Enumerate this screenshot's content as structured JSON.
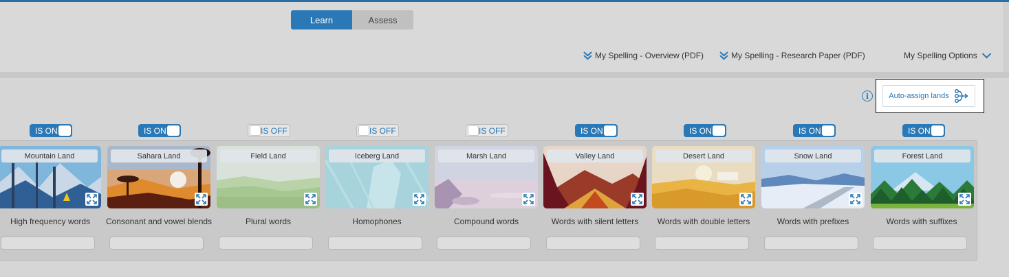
{
  "mode_toggle": {
    "learn_label": "Learn",
    "assess_label": "Assess",
    "active": "Learn"
  },
  "links": {
    "overview": "My Spelling - Overview (PDF)",
    "research": "My Spelling - Research Paper (PDF)",
    "options": "My Spelling Options"
  },
  "auto_assign": {
    "label": "Auto-assign lands",
    "info_glyph": "i"
  },
  "colors": {
    "accent": "#2a78b5",
    "toggle_on": "#2a78b5",
    "toggle_off": "#e6e6e6"
  },
  "lands": [
    {
      "name": "Mountain Land",
      "description": "High frequency words",
      "toggle": "IS ON",
      "input_value": ""
    },
    {
      "name": "Sahara Land",
      "description": "Consonant and vowel blends",
      "toggle": "IS ON",
      "input_value": ""
    },
    {
      "name": "Field Land",
      "description": "Plural words",
      "toggle": "IS OFF",
      "input_value": ""
    },
    {
      "name": "Iceberg Land",
      "description": "Homophones",
      "toggle": "IS OFF",
      "input_value": ""
    },
    {
      "name": "Marsh Land",
      "description": "Compound words",
      "toggle": "IS OFF",
      "input_value": ""
    },
    {
      "name": "Valley Land",
      "description": "Words with silent letters",
      "toggle": "IS ON",
      "input_value": ""
    },
    {
      "name": "Desert Land",
      "description": "Words with double letters",
      "toggle": "IS ON",
      "input_value": ""
    },
    {
      "name": "Snow Land",
      "description": "Words with prefixes",
      "toggle": "IS ON",
      "input_value": ""
    },
    {
      "name": "Forest Land",
      "description": "Words with suffixes",
      "toggle": "IS ON",
      "input_value": ""
    }
  ]
}
